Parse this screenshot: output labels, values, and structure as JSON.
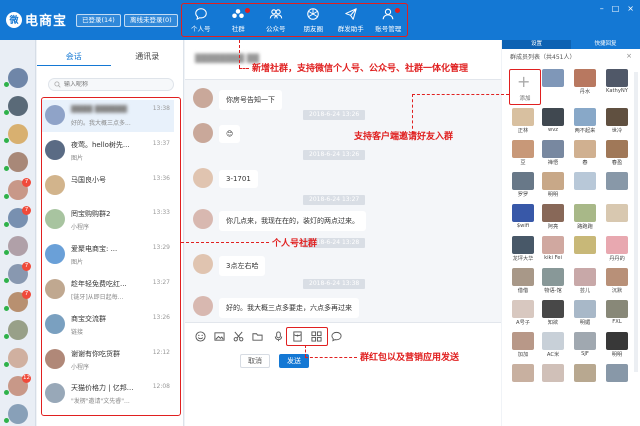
{
  "app": {
    "logo_char": "微",
    "name": "电商宝"
  },
  "status": {
    "logged_in": "已登录(14)",
    "offline": "离线未登录(0)"
  },
  "nav": [
    {
      "label": "个人号",
      "icon": "chat-bubble-icon"
    },
    {
      "label": "社群",
      "icon": "group-icon"
    },
    {
      "label": "公众号",
      "icon": "official-account-icon"
    },
    {
      "label": "朋友圈",
      "icon": "moments-icon"
    },
    {
      "label": "群发助手",
      "icon": "broadcast-icon"
    },
    {
      "label": "账号管理",
      "icon": "account-manage-icon"
    }
  ],
  "sessions": {
    "tabs": [
      "会话",
      "通讯录"
    ],
    "search_placeholder": "输入昵称",
    "items": [
      {
        "name": "",
        "preview": "好的。我大概三点多...",
        "time": "13:38",
        "color": "#8fa3c8",
        "selected": true
      },
      {
        "name": "夜莺。hello树先...",
        "preview": "图片",
        "time": "13:37",
        "color": "#5a6b84"
      },
      {
        "name": "马国良小号",
        "preview": "",
        "time": "13:36",
        "color": "#d2b48c"
      },
      {
        "name": "罔宝购购群2",
        "preview": "小程序",
        "time": "13:33",
        "color": "#a8c4a0"
      },
      {
        "name": "爱聚电商宝: ...",
        "preview": "图片",
        "time": "13:29",
        "color": "#6aa0d8"
      },
      {
        "name": "趁年轻免费吃红...",
        "preview": "[链牙]从即日起每...",
        "time": "13:27",
        "color": "#c0a890"
      },
      {
        "name": "商宝交流群",
        "preview": "链接",
        "time": "13:26",
        "color": "#7aa0c0"
      },
      {
        "name": "谢谢有你吃货群",
        "preview": "小程序",
        "time": "12:12",
        "color": "#b08878"
      },
      {
        "name": "天猫价格力 | 亿邦...",
        "preview": "\"发楞\"邀请\"文先睿\"...",
        "time": "12:08",
        "color": "#98a8b8"
      }
    ]
  },
  "chat": {
    "title": "",
    "date_label": "2018-6-24 13:26",
    "messages": [
      {
        "text": "你房号告知一下",
        "color": "#c9a89a"
      },
      {
        "text": "😊",
        "color": "#c9a89a"
      },
      {
        "text": "3-1701",
        "color": "#e0c4b0"
      },
      {
        "text": "你几点来，我现在在的，装灯的两点过来。",
        "color": "#d8b8b0"
      },
      {
        "text": "3点左右哈",
        "color": "#e0c4b0"
      },
      {
        "text": "好的。我大概三点多要走，六点多再过来",
        "color": "#d8b8b0"
      }
    ],
    "dates": [
      "2018-6-24 13:26",
      "2018-6-24 13:26",
      "2018-6-24 13:27",
      "2018-6-24 13:28",
      "2018-6-24 13:38"
    ],
    "tools": [
      "smiley-icon",
      "image-icon",
      "scissors-icon",
      "folder-icon",
      "microphone-icon",
      "red-packet-icon",
      "app-grid-icon",
      "chat-icon"
    ],
    "cancel_label": "取消",
    "send_label": "发送"
  },
  "right": {
    "tabs": [
      "设置",
      "快捷回复"
    ],
    "header": "群成员列表（共451人）",
    "add_label": "添加",
    "members": [
      {
        "name": "",
        "color": "#7f97b8"
      },
      {
        "name": "丹水",
        "color": "#b87860"
      },
      {
        "name": "KathyNY",
        "color": "#505868"
      },
      {
        "name": "正林",
        "color": "#d8c0a0"
      },
      {
        "name": "wvz",
        "color": "#404850"
      },
      {
        "name": "两不起来",
        "color": "#88a8c8"
      },
      {
        "name": "世冷",
        "color": "#605040"
      },
      {
        "name": "豆",
        "color": "#c89878"
      },
      {
        "name": "禅悟",
        "color": "#7888a0"
      },
      {
        "name": "春",
        "color": "#d0b090"
      },
      {
        "name": "春盈",
        "color": "#a07858"
      },
      {
        "name": "罗罗",
        "color": "#687888"
      },
      {
        "name": "明明",
        "color": "#c8a888"
      },
      {
        "name": "",
        "color": "#b8c8d8"
      },
      {
        "name": "",
        "color": "#8898a8"
      },
      {
        "name": "$wifi",
        "color": "#3858a8"
      },
      {
        "name": "阿亮",
        "color": "#886858"
      },
      {
        "name": "路跑跑",
        "color": "#a8b888"
      },
      {
        "name": "",
        "color": "#d8c8b0"
      },
      {
        "name": "龙坪大华",
        "color": "#485868"
      },
      {
        "name": "kiki Fei",
        "color": "#d0a8a0"
      },
      {
        "name": "",
        "color": "#c8b878"
      },
      {
        "name": "丹丹的",
        "color": "#e8a8b0"
      },
      {
        "name": "借借",
        "color": "#a89888"
      },
      {
        "name": "物语-馆",
        "color": "#889898"
      },
      {
        "name": "芸儿",
        "color": "#c8a8a8"
      },
      {
        "name": "沉默",
        "color": "#b89078"
      },
      {
        "name": "A号子",
        "color": "#d8c8c0"
      },
      {
        "name": "知欲",
        "color": "#484848"
      },
      {
        "name": "明媚",
        "color": "#a8b8c8"
      },
      {
        "name": "FXL",
        "color": "#888878"
      },
      {
        "name": "加加",
        "color": "#b89888"
      },
      {
        "name": "AC米",
        "color": "#c8d0d8"
      },
      {
        "name": "SJF",
        "color": "#a0a8b0"
      },
      {
        "name": "明明",
        "color": "#383838"
      },
      {
        "name": "",
        "color": "#c8b0a0"
      },
      {
        "name": "",
        "color": "#d0c0b8"
      },
      {
        "name": "",
        "color": "#b8a890"
      },
      {
        "name": "",
        "color": "#8898a8"
      }
    ]
  },
  "left_avatars": [
    {
      "color": "#6f86a8",
      "badge": ""
    },
    {
      "color": "#5a6a78",
      "badge": ""
    },
    {
      "color": "#d8b070",
      "badge": ""
    },
    {
      "color": "#a88878",
      "badge": ""
    },
    {
      "color": "#c89888",
      "badge": "7"
    },
    {
      "color": "#7890b0",
      "badge": "7"
    },
    {
      "color": "#b0a0a8",
      "badge": ""
    },
    {
      "color": "#8898b0",
      "badge": "7"
    },
    {
      "color": "#b89070",
      "badge": "7"
    },
    {
      "color": "#98a088",
      "badge": ""
    },
    {
      "color": "#d0b0a0",
      "badge": ""
    },
    {
      "color": "#c89888",
      "badge": "12"
    },
    {
      "color": "#88a0b8",
      "badge": ""
    }
  ],
  "annotations": {
    "social": "新增社群，支持微信个人号、公众号、社群一体化管理",
    "invite": "支持客户端邀请好友入群",
    "personal": "个人号社群",
    "marketing": "群红包以及营销应用发送"
  },
  "colors": {
    "primary": "#1478d4",
    "accent_red": "#e02020",
    "online": "#2fb24a",
    "badge": "#f04a3a"
  }
}
